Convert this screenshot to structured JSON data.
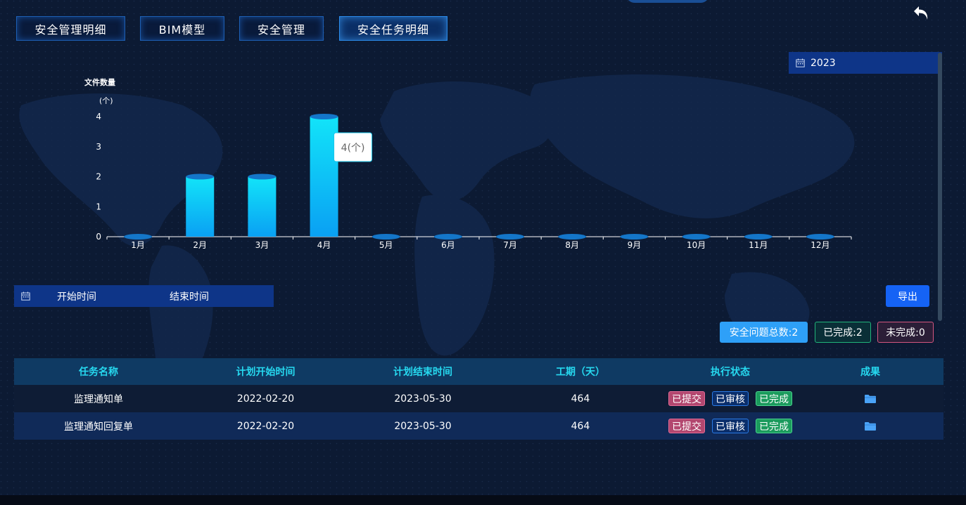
{
  "nav": {
    "tabs": [
      {
        "label": "安全管理明细",
        "active": false
      },
      {
        "label": "BIM模型",
        "active": false
      },
      {
        "label": "安全管理",
        "active": false
      },
      {
        "label": "安全任务明细",
        "active": true
      }
    ]
  },
  "icons": {
    "back": "undo-arrow-icon",
    "calendar": "calendar-icon",
    "folder": "folder-icon"
  },
  "year_picker": {
    "value": "2023"
  },
  "chart_data": {
    "type": "bar",
    "ylabel": "文件数量",
    "yunit": "(个)",
    "categories": [
      "1月",
      "2月",
      "3月",
      "4月",
      "5月",
      "6月",
      "7月",
      "8月",
      "9月",
      "10月",
      "11月",
      "12月"
    ],
    "values": [
      0,
      2,
      2,
      4,
      0,
      0,
      0,
      0,
      0,
      0,
      0,
      0
    ],
    "ylim": [
      0,
      4
    ],
    "yticks": [
      0,
      1,
      2,
      3,
      4
    ],
    "tooltip": {
      "category_index": 3,
      "text": "4(个)"
    },
    "colors": {
      "bar_top": "#12e4f9",
      "bar_bottom": "#0aa0f3",
      "cap": "#1476c9"
    }
  },
  "filters": {
    "start_placeholder": "开始时间",
    "end_placeholder": "结束时间",
    "export_label": "导出"
  },
  "summary": {
    "total": "安全问题总数:2",
    "completed": "已完成:2",
    "uncompleted": "未完成:0"
  },
  "table": {
    "headers": [
      "任务名称",
      "计划开始时间",
      "计划结束时间",
      "工期（天）",
      "执行状态",
      "成果"
    ],
    "rows": [
      {
        "name": "监理通知单",
        "start": "2022-02-20",
        "end": "2023-05-30",
        "days": "464",
        "status": [
          "已提交",
          "已审核",
          "已完成"
        ]
      },
      {
        "name": "监理通知回复单",
        "start": "2022-02-20",
        "end": "2023-05-30",
        "days": "464",
        "status": [
          "已提交",
          "已审核",
          "已完成"
        ]
      }
    ]
  },
  "colors": {
    "background": "#0c1a33",
    "accent_cyan": "#26d9f0",
    "primary_blue": "#1563f5",
    "status_submitted": "#b3476f",
    "status_reviewed": "#0a2e6b",
    "status_completed": "#1b9b5d"
  }
}
